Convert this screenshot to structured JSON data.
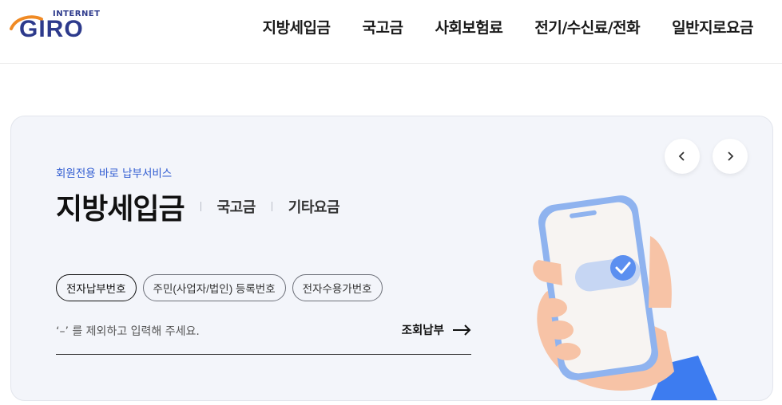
{
  "header": {
    "logo_top": "INTERNET",
    "logo_main": "GIRO",
    "nav": [
      {
        "label": "지방세입금"
      },
      {
        "label": "국고금"
      },
      {
        "label": "사회보험료"
      },
      {
        "label": "전기/수신료/전화"
      },
      {
        "label": "일반지로요금"
      }
    ]
  },
  "hero": {
    "subtitle": "회원전용 바로 납부서비스",
    "tabs": {
      "active": "지방세입금",
      "others": [
        "국고금",
        "기타요금"
      ]
    },
    "chips": [
      {
        "label": "전자납부번호",
        "active": true
      },
      {
        "label": "주민(사업자/법인) 등록번호",
        "active": false
      },
      {
        "label": "전자수용가번호",
        "active": false
      }
    ],
    "search": {
      "placeholder": "‘–’ 를 제외하고 입력해 주세요.",
      "value": ""
    },
    "submit_label": "조회납부"
  },
  "icons": {
    "prev": "chevron-left-icon",
    "next": "chevron-right-icon",
    "submit": "arrow-right-icon",
    "illustration": "phone-toggle-illustration"
  },
  "colors": {
    "brand": "#2d3a8c",
    "accent": "#2f5bd1",
    "logo_orange": "#f08a24",
    "card_bg": "#f3f5fa"
  }
}
